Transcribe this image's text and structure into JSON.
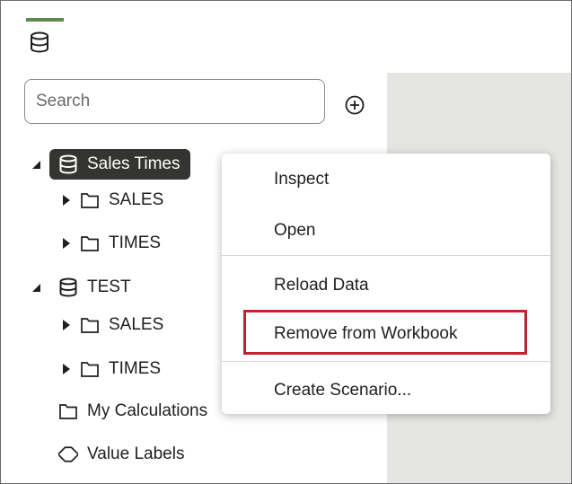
{
  "sidebar": {
    "search_placeholder": "Search",
    "tree": [
      {
        "label": "Sales Times",
        "type": "database",
        "expanded": true,
        "selected": true
      },
      {
        "label": "SALES",
        "type": "folder",
        "collapsed": true
      },
      {
        "label": "TIMES",
        "type": "folder",
        "collapsed": true
      },
      {
        "label": "TEST",
        "type": "database",
        "expanded": true
      },
      {
        "label": "SALES",
        "type": "folder",
        "collapsed": true
      },
      {
        "label": "TIMES",
        "type": "folder",
        "collapsed": true
      },
      {
        "label": "My Calculations",
        "type": "folder"
      },
      {
        "label": "Value Labels",
        "type": "tag"
      }
    ]
  },
  "context_menu": {
    "items": [
      {
        "label": "Inspect"
      },
      {
        "label": "Open"
      },
      {
        "label": "Reload Data"
      },
      {
        "label": "Remove from Workbook",
        "highlighted": true
      },
      {
        "label": "Create Scenario..."
      }
    ]
  },
  "colors": {
    "accent": "#5b8a4e",
    "selected_bg": "#343432",
    "highlight_border": "#c3212f",
    "canvas_bg": "#e5e5e3"
  }
}
